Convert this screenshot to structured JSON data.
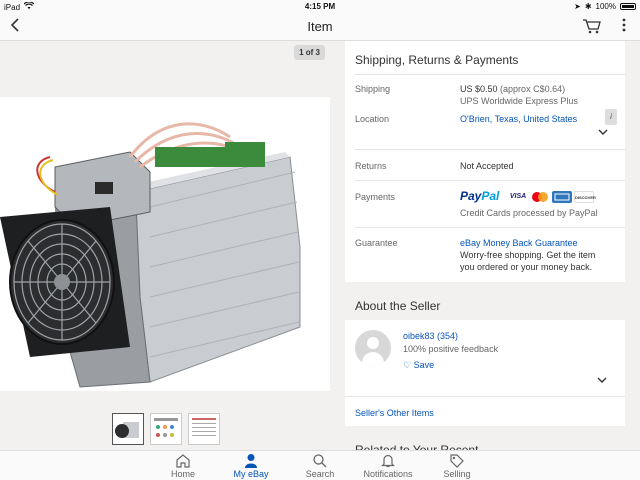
{
  "status_bar": {
    "device": "iPad",
    "time": "4:15 PM",
    "battery": "100%"
  },
  "nav": {
    "title": "Item"
  },
  "gallery": {
    "counter": "1 of 3"
  },
  "shipping_section": {
    "title": "Shipping, Returns & Payments",
    "shipping_label": "Shipping",
    "shipping_price": "US $0.50",
    "shipping_approx": "(approx C$0.64)",
    "shipping_service": "UPS Worldwide Express Plus",
    "location_label": "Location",
    "location_value": "O'Brien, Texas, United States",
    "returns_label": "Returns",
    "returns_value": "Not Accepted",
    "payments_label": "Payments",
    "paypal_pay": "Pay",
    "paypal_pal": "Pal",
    "visa": "VISA",
    "discover": "DISCOVER",
    "payments_note": "Credit Cards processed by PayPal",
    "guarantee_label": "Guarantee",
    "guarantee_title": "eBay Money Back Guarantee",
    "guarantee_line1": "Worry-free shopping. Get the item",
    "guarantee_line2": "you ordered or your money back."
  },
  "seller_section": {
    "title": "About the Seller",
    "seller_name": "oibek83 (354)",
    "feedback": "100% positive feedback",
    "save_label": "Save",
    "other_items": "Seller's Other Items",
    "next_section_partial": "Related to Your Recent"
  },
  "tabbar": [
    {
      "label": "Home"
    },
    {
      "label": "My eBay"
    },
    {
      "label": "Search"
    },
    {
      "label": "Notifications"
    },
    {
      "label": "Selling"
    }
  ],
  "colors": {
    "link": "#0654ba",
    "paypal_dark": "#003087",
    "paypal_light": "#009cde"
  }
}
